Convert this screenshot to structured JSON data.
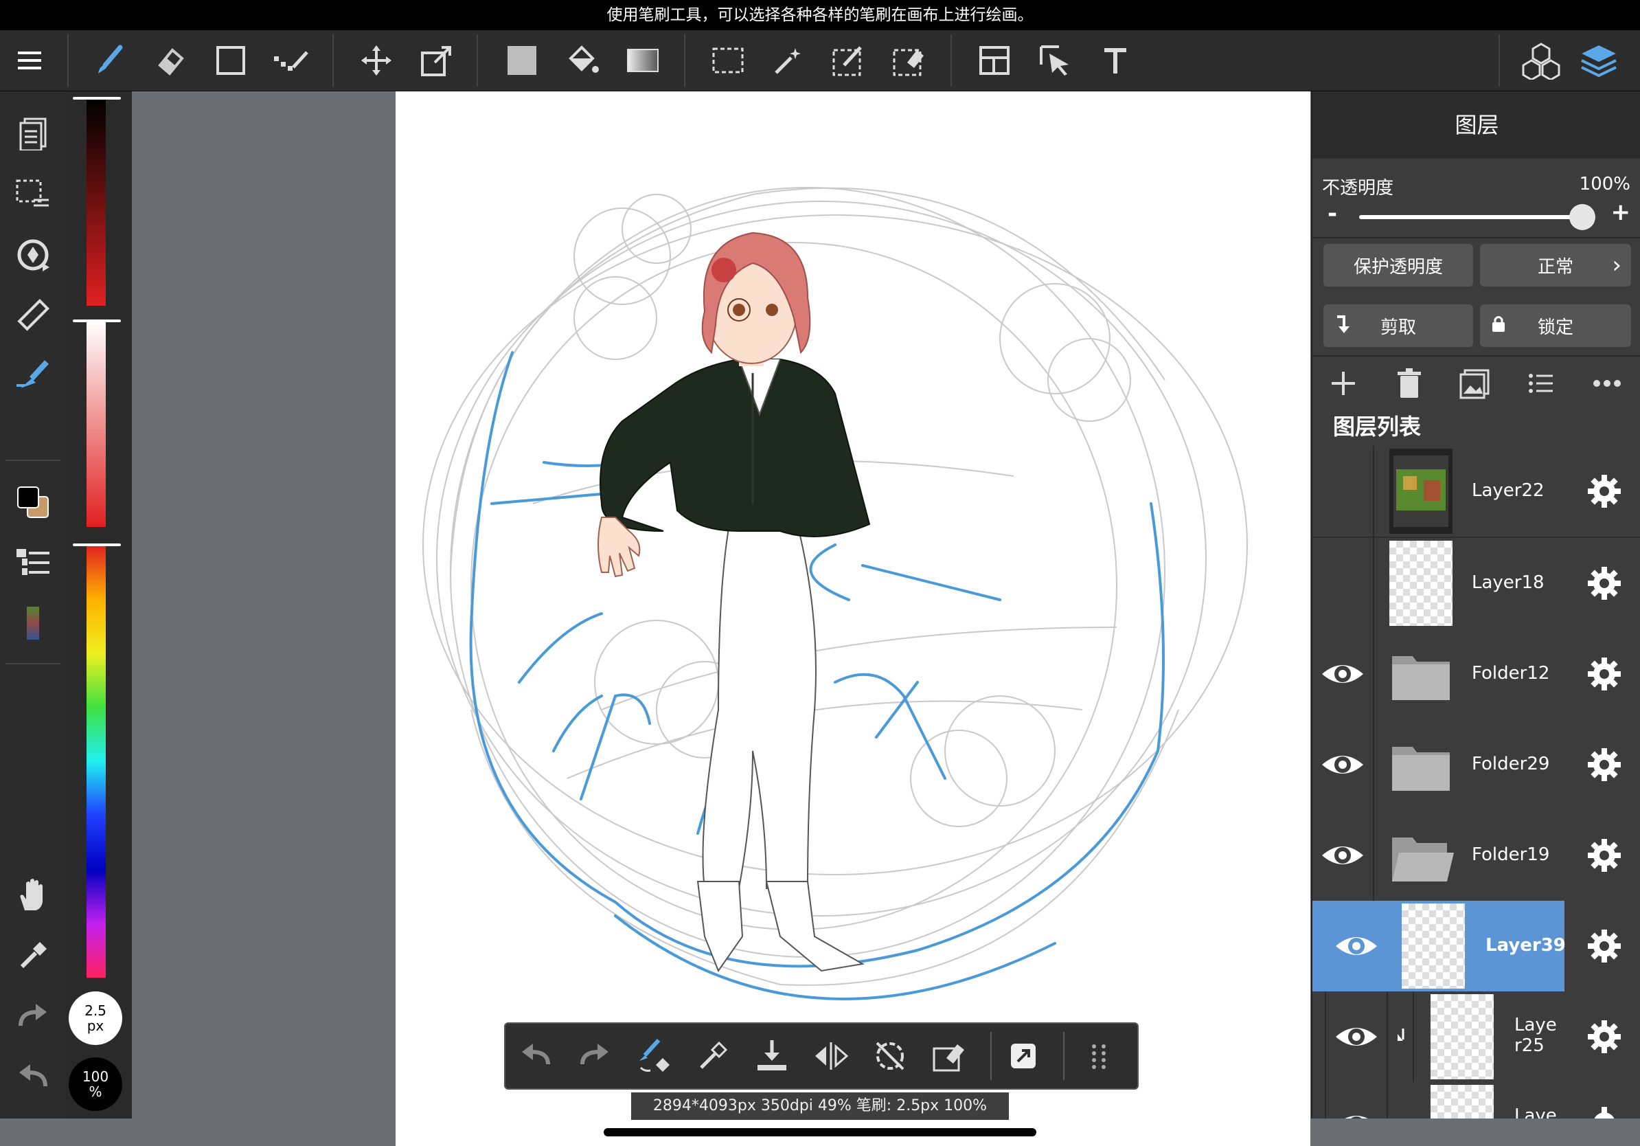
{
  "status_bar": {
    "hint": "使用笔刷工具，可以选择各种各样的笔刷在画布上进行绘画。"
  },
  "toolbar": {
    "icons": [
      "menu-icon",
      "brush-icon",
      "eraser-icon",
      "shape-icon",
      "dot-brush-icon",
      "move-icon",
      "transform-icon",
      "fill-color-icon",
      "bucket-icon",
      "gradient-icon",
      "select-rect-icon",
      "magic-wand-icon",
      "select-pen-icon",
      "select-eraser-icon",
      "frame-icon",
      "operation-icon",
      "text-icon",
      "3d-icon",
      "layers-icon"
    ]
  },
  "sidebar": {
    "icons": [
      "pages-icon",
      "selection-list-icon",
      "rotate-icon",
      "ruler-icon",
      "snap-brush-icon",
      "color-swatch-icon",
      "layer-list-icon",
      "color-mix-icon",
      "hand-icon",
      "eyedropper-icon",
      "redo-icon",
      "undo-icon"
    ]
  },
  "colorbar": {
    "brush_size_value": "2.5",
    "brush_size_unit": "px",
    "opacity_value": "100",
    "opacity_unit": "%"
  },
  "bottom_toolbar": {
    "icons": [
      "undo-icon",
      "redo-icon",
      "brush-eraser-switch-icon",
      "eyedropper-icon",
      "import-icon",
      "flip-icon",
      "rotate-reset-icon",
      "clear-icon",
      "share-icon",
      "grip-icon"
    ]
  },
  "info_bar": {
    "text": "2894*4093px 350dpi 49% 笔刷: 2.5px 100%"
  },
  "layer_panel": {
    "title": "图层",
    "opacity_label": "不透明度",
    "opacity_value": "100%",
    "opacity_level": 1.0,
    "minus": "-",
    "plus": "+",
    "protect_alpha": "保护透明度",
    "blend_mode": "正常",
    "clip": "剪取",
    "lock": "锁定",
    "layer_list_title": "图层列表",
    "layers": [
      {
        "name": "Layer22",
        "visible": false,
        "type": "image"
      },
      {
        "name": "Layer18",
        "visible": false,
        "type": "blank"
      },
      {
        "name": "Folder12",
        "visible": true,
        "type": "folder"
      },
      {
        "name": "Folder29",
        "visible": true,
        "type": "folder"
      },
      {
        "name": "Folder19",
        "visible": true,
        "type": "folder-open"
      },
      {
        "name": "Layer39",
        "visible": true,
        "type": "blank",
        "selected": true
      },
      {
        "name": "Laye\nr25",
        "visible": true,
        "type": "blank",
        "clipped": true
      },
      {
        "name": "Laye",
        "visible": true,
        "type": "blank"
      }
    ]
  },
  "colors": {
    "accent_blue": "#4a90d9",
    "selected_layer": "#5b95d5",
    "sketch_blue": "#4a9ad8",
    "jacket": "#1f2a1e",
    "hair": "#d97b74"
  }
}
